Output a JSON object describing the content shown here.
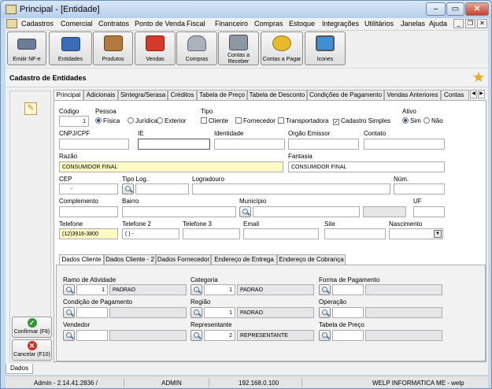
{
  "window": {
    "title": "Principal - [Entidade]"
  },
  "menu": [
    "Cadastros",
    "Comercial",
    "Contratos",
    "Ponto de Venda",
    "Fiscal",
    "Financeiro",
    "Compras",
    "Estoque",
    "Integrações",
    "Utilitários",
    "Janelas",
    "Ajuda"
  ],
  "toolbar": [
    {
      "label": "Emitir NF-e",
      "icon": "printer-icon"
    },
    {
      "label": "Entidades",
      "icon": "entities-icon"
    },
    {
      "label": "Produtos",
      "icon": "box-icon"
    },
    {
      "label": "Vendas",
      "icon": "gift-icon"
    },
    {
      "label": "Compras",
      "icon": "basket-icon"
    },
    {
      "label": "Contas a Receber",
      "icon": "cash-register-icon"
    },
    {
      "label": "Contas a Pagar",
      "icon": "coins-icon"
    },
    {
      "label": "Icones",
      "icon": "monitor-icon"
    }
  ],
  "page": {
    "title": "Cadastro de Entidades"
  },
  "side": {
    "confirm": "Confirmar (F8)",
    "cancel": "Cancelar (F10)"
  },
  "tabs": [
    "Principal",
    "Adicionais",
    "Sintegra/Serasa",
    "Créditos",
    "Tabela de Preço",
    "Tabela de Desconto",
    "Condições de Pagamento",
    "Vendas Anteriores",
    "Contas a"
  ],
  "form": {
    "codigo_label": "Código",
    "codigo": "1",
    "pessoa_label": "Pessoa",
    "pessoa_options": [
      "Física",
      "Jurídica",
      "Exterior"
    ],
    "tipo_label": "Tipo",
    "tipo_options": [
      "Cliente",
      "Fornecedor",
      "Transportadora",
      "Cadastro Simples"
    ],
    "ativo_label": "Ativo",
    "ativo_options": [
      "Sim",
      "Não"
    ],
    "cnpj_label": "CNPJ/CPF",
    "ie_label": "IE",
    "identidade_label": "Identidade",
    "orgao_label": "Orgão Emissor",
    "contato_label": "Contato",
    "razao_label": "Razão",
    "razao": "CONSUMIDOR FINAL",
    "fantasia_label": "Fantasia",
    "fantasia": "CONSUMIDOR FINAL",
    "cep_label": "CEP",
    "cep": "-",
    "tipolog_label": "Tipo Log.",
    "logradouro_label": "Logradouro",
    "num_label": "Núm.",
    "complemento_label": "Complemento",
    "bairro_label": "Bairro",
    "municipio_label": "Município",
    "uf_label": "UF",
    "telefone_label": "Telefone",
    "telefone": "(12)3916-3800",
    "telefone2_label": "Telefone 2",
    "telefone2": "(  )   -",
    "telefone3_label": "Telefone 3",
    "email_label": "Email",
    "site_label": "Site",
    "nascimento_label": "Nascimento"
  },
  "subtabs": [
    "Dados Cliente",
    "Dados Cliente - 2",
    "Dados Fornecedor",
    "Endereço de Entrega",
    "Endereço de Cobrança"
  ],
  "cliente": {
    "ramo_label": "Ramo de Atividade",
    "ramo_code": "1",
    "ramo": "PADRAO",
    "categoria_label": "Categoria",
    "categoria_code": "1",
    "categoria": "PADRAO",
    "forma_label": "Forma de Pagamento",
    "condicao_label": "Condição de Pagamento",
    "regiao_label": "Região",
    "regiao_code": "1",
    "regiao": "PADRAO",
    "operacao_label": "Operação",
    "vendedor_label": "Vendedor",
    "representante_label": "Representante",
    "representante_code": "2",
    "representante": "REPRESENTANTE",
    "tabela_label": "Tabela de Preço"
  },
  "bottom_tab": "Dados",
  "status": {
    "version": "Admin - 2.14.41.2836 /",
    "user": "ADMIN",
    "ip": "192.168.0.100",
    "company": "WELP INFORMATICA ME - welp"
  }
}
